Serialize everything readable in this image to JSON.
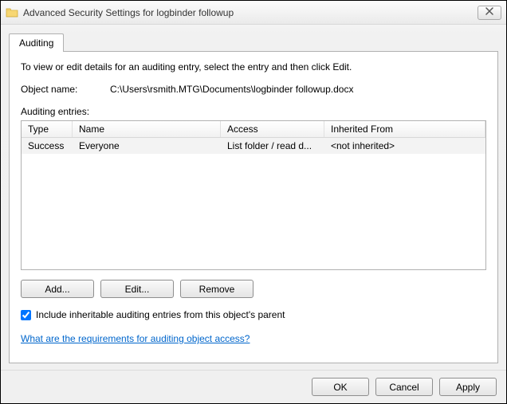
{
  "window": {
    "title": "Advanced Security Settings for logbinder followup"
  },
  "tabs": {
    "auditing": "Auditing"
  },
  "panel": {
    "instruction": "To view or edit details for an auditing entry, select the entry and then click Edit.",
    "object_name_label": "Object name:",
    "object_name_value": "C:\\Users\\rsmith.MTG\\Documents\\logbinder followup.docx",
    "entries_label": "Auditing entries:",
    "columns": {
      "type": "Type",
      "name": "Name",
      "access": "Access",
      "inherited": "Inherited From"
    },
    "rows": [
      {
        "type": "Success",
        "name": "Everyone",
        "access": "List folder / read d...",
        "inherited": "<not inherited>"
      }
    ],
    "buttons": {
      "add": "Add...",
      "edit": "Edit...",
      "remove": "Remove"
    },
    "checkbox_label": "Include inheritable auditing entries from this object's parent",
    "help_link": "What are the requirements for auditing object access?"
  },
  "footer": {
    "ok": "OK",
    "cancel": "Cancel",
    "apply": "Apply"
  }
}
